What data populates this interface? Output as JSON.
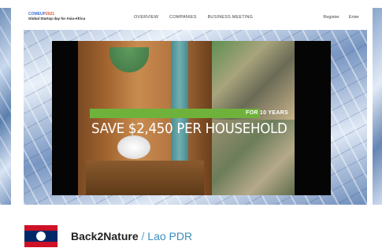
{
  "site": {
    "logo_brand": "COMEUP",
    "logo_year": "2021",
    "logo_tagline": "Global Startup day for Asia-Africa",
    "nav_links": [
      "OVERVIEW",
      "COMPANIES",
      "BUSINESS MEETING"
    ],
    "nav_register": "Register",
    "nav_enter": "Enter"
  },
  "video": {
    "overlay_small": "FOR 10 YEARS",
    "overlay_headline": "SAVE $2,450 PER HOUSEHOLD"
  },
  "startup": {
    "name": "Back2Nature",
    "separator": " / ",
    "country": "Lao PDR",
    "flag_colors": {
      "red": "#ce1126",
      "blue": "#002868",
      "white": "#ffffff"
    }
  },
  "colors": {
    "overlay_bar": "#6fb23b",
    "country_link": "#3a8fc0"
  }
}
